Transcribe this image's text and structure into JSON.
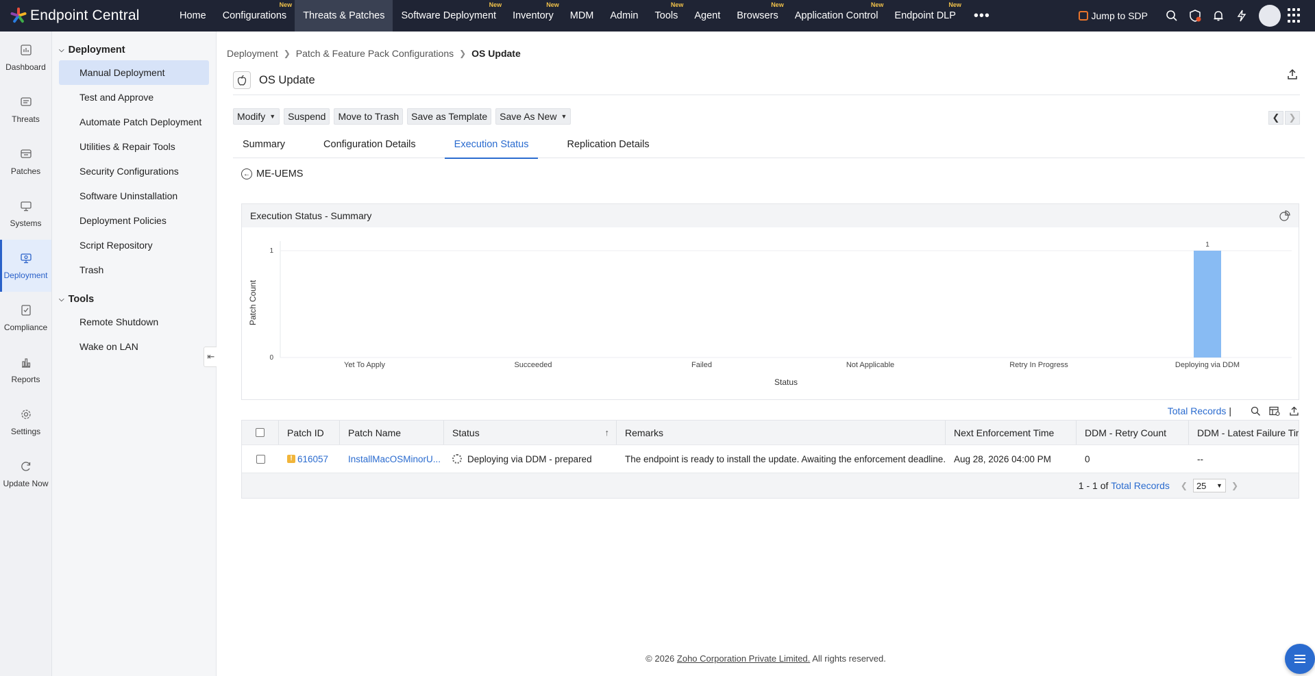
{
  "app": {
    "brand": "Endpoint Central"
  },
  "topnav": {
    "items": [
      {
        "label": "Home",
        "new": ""
      },
      {
        "label": "Configurations",
        "new": "New"
      },
      {
        "label": "Threats & Patches",
        "new": "",
        "active": true
      },
      {
        "label": "Software Deployment",
        "new": "New"
      },
      {
        "label": "Inventory",
        "new": "New"
      },
      {
        "label": "MDM",
        "new": ""
      },
      {
        "label": "Admin",
        "new": ""
      },
      {
        "label": "Tools",
        "new": "New"
      },
      {
        "label": "Agent",
        "new": ""
      },
      {
        "label": "Browsers",
        "new": "New"
      },
      {
        "label": "Application Control",
        "new": "New"
      },
      {
        "label": "Endpoint DLP",
        "new": "New"
      }
    ],
    "more": "•••",
    "jump_label": "Jump to SDP"
  },
  "rail": {
    "items": [
      {
        "label": "Dashboard",
        "icon": "dashboard-icon"
      },
      {
        "label": "Threats",
        "icon": "threats-icon"
      },
      {
        "label": "Patches",
        "icon": "patches-icon"
      },
      {
        "label": "Systems",
        "icon": "systems-icon"
      },
      {
        "label": "Deployment",
        "icon": "deployment-icon",
        "active": true
      },
      {
        "label": "Compliance",
        "icon": "compliance-icon"
      },
      {
        "label": "Reports",
        "icon": "reports-icon"
      },
      {
        "label": "Settings",
        "icon": "settings-icon"
      },
      {
        "label": "Update Now",
        "icon": "update-icon"
      }
    ]
  },
  "sidebar": {
    "deployment_title": "Deployment",
    "deployment_items": [
      {
        "label": "Manual Deployment",
        "active": true
      },
      {
        "label": "Test and Approve"
      },
      {
        "label": "Automate Patch Deployment"
      },
      {
        "label": "Utilities & Repair Tools"
      },
      {
        "label": "Security Configurations"
      },
      {
        "label": "Software Uninstallation"
      },
      {
        "label": "Deployment Policies"
      },
      {
        "label": "Script Repository"
      },
      {
        "label": "Trash"
      }
    ],
    "tools_title": "Tools",
    "tools_items": [
      {
        "label": "Remote Shutdown"
      },
      {
        "label": "Wake on LAN"
      }
    ]
  },
  "breadcrumb": [
    "Deployment",
    "Patch & Feature Pack Configurations",
    "OS Update"
  ],
  "page": {
    "title": "OS Update"
  },
  "toolbar": {
    "modify": "Modify",
    "suspend": "Suspend",
    "move_to_trash": "Move to Trash",
    "save_template": "Save as Template",
    "save_as_new": "Save As New"
  },
  "tabs": [
    "Summary",
    "Configuration Details",
    "Execution Status",
    "Replication Details"
  ],
  "active_tab": "Execution Status",
  "back_label": "ME-UEMS",
  "chart_panel": {
    "title": "Execution Status - Summary"
  },
  "chart_data": {
    "type": "bar",
    "categories": [
      "Yet To Apply",
      "Succeeded",
      "Failed",
      "Not Applicable",
      "Retry In Progress",
      "Deploying via DDM"
    ],
    "values": [
      0,
      0,
      0,
      0,
      0,
      1
    ],
    "data_labels": [
      "",
      "",
      "",
      "",
      "",
      "1"
    ],
    "xlabel": "Status",
    "ylabel": "Patch Count",
    "ylim": [
      0,
      1
    ],
    "yticks": [
      "0",
      "1"
    ],
    "bar_color": "#88bbf3",
    "grid": true
  },
  "table": {
    "total_records_link": "Total Records",
    "pipe": "|",
    "columns": [
      "Patch ID",
      "Patch Name",
      "Status",
      "Remarks",
      "Next Enforcement Time",
      "DDM - Retry Count",
      "DDM - Latest Failure Time"
    ],
    "rows": [
      {
        "patch_id": "616057",
        "patch_name": "InstallMacOSMinorU...",
        "status": "Deploying via DDM - prepared",
        "remarks": "The endpoint is ready to install the update. Awaiting the enforcement deadline.",
        "next_enforcement": "Aug 28, 2026 04:00 PM",
        "retry_count": "0",
        "latest_failure": "--"
      }
    ],
    "footer": {
      "range": "1 - 1 of",
      "total_link": "Total Records",
      "page_size": "25"
    }
  },
  "footer": {
    "prefix": "© 2026",
    "company": "Zoho Corporation Private Limited.",
    "suffix": "All rights reserved."
  }
}
